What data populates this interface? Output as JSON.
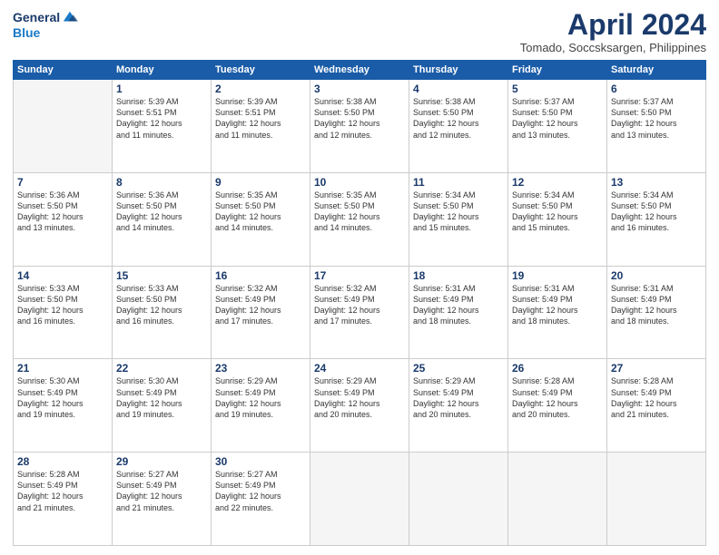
{
  "header": {
    "logo_general": "General",
    "logo_blue": "Blue",
    "month_title": "April 2024",
    "location": "Tomado, Soccsksargen, Philippines"
  },
  "weekdays": [
    "Sunday",
    "Monday",
    "Tuesday",
    "Wednesday",
    "Thursday",
    "Friday",
    "Saturday"
  ],
  "weeks": [
    [
      {
        "day": "",
        "sunrise": "",
        "sunset": "",
        "daylight": ""
      },
      {
        "day": "1",
        "sunrise": "Sunrise: 5:39 AM",
        "sunset": "Sunset: 5:51 PM",
        "daylight": "Daylight: 12 hours and 11 minutes."
      },
      {
        "day": "2",
        "sunrise": "Sunrise: 5:39 AM",
        "sunset": "Sunset: 5:51 PM",
        "daylight": "Daylight: 12 hours and 11 minutes."
      },
      {
        "day": "3",
        "sunrise": "Sunrise: 5:38 AM",
        "sunset": "Sunset: 5:50 PM",
        "daylight": "Daylight: 12 hours and 12 minutes."
      },
      {
        "day": "4",
        "sunrise": "Sunrise: 5:38 AM",
        "sunset": "Sunset: 5:50 PM",
        "daylight": "Daylight: 12 hours and 12 minutes."
      },
      {
        "day": "5",
        "sunrise": "Sunrise: 5:37 AM",
        "sunset": "Sunset: 5:50 PM",
        "daylight": "Daylight: 12 hours and 13 minutes."
      },
      {
        "day": "6",
        "sunrise": "Sunrise: 5:37 AM",
        "sunset": "Sunset: 5:50 PM",
        "daylight": "Daylight: 12 hours and 13 minutes."
      }
    ],
    [
      {
        "day": "7",
        "sunrise": "Sunrise: 5:36 AM",
        "sunset": "Sunset: 5:50 PM",
        "daylight": "Daylight: 12 hours and 13 minutes."
      },
      {
        "day": "8",
        "sunrise": "Sunrise: 5:36 AM",
        "sunset": "Sunset: 5:50 PM",
        "daylight": "Daylight: 12 hours and 14 minutes."
      },
      {
        "day": "9",
        "sunrise": "Sunrise: 5:35 AM",
        "sunset": "Sunset: 5:50 PM",
        "daylight": "Daylight: 12 hours and 14 minutes."
      },
      {
        "day": "10",
        "sunrise": "Sunrise: 5:35 AM",
        "sunset": "Sunset: 5:50 PM",
        "daylight": "Daylight: 12 hours and 14 minutes."
      },
      {
        "day": "11",
        "sunrise": "Sunrise: 5:34 AM",
        "sunset": "Sunset: 5:50 PM",
        "daylight": "Daylight: 12 hours and 15 minutes."
      },
      {
        "day": "12",
        "sunrise": "Sunrise: 5:34 AM",
        "sunset": "Sunset: 5:50 PM",
        "daylight": "Daylight: 12 hours and 15 minutes."
      },
      {
        "day": "13",
        "sunrise": "Sunrise: 5:34 AM",
        "sunset": "Sunset: 5:50 PM",
        "daylight": "Daylight: 12 hours and 16 minutes."
      }
    ],
    [
      {
        "day": "14",
        "sunrise": "Sunrise: 5:33 AM",
        "sunset": "Sunset: 5:50 PM",
        "daylight": "Daylight: 12 hours and 16 minutes."
      },
      {
        "day": "15",
        "sunrise": "Sunrise: 5:33 AM",
        "sunset": "Sunset: 5:50 PM",
        "daylight": "Daylight: 12 hours and 16 minutes."
      },
      {
        "day": "16",
        "sunrise": "Sunrise: 5:32 AM",
        "sunset": "Sunset: 5:49 PM",
        "daylight": "Daylight: 12 hours and 17 minutes."
      },
      {
        "day": "17",
        "sunrise": "Sunrise: 5:32 AM",
        "sunset": "Sunset: 5:49 PM",
        "daylight": "Daylight: 12 hours and 17 minutes."
      },
      {
        "day": "18",
        "sunrise": "Sunrise: 5:31 AM",
        "sunset": "Sunset: 5:49 PM",
        "daylight": "Daylight: 12 hours and 18 minutes."
      },
      {
        "day": "19",
        "sunrise": "Sunrise: 5:31 AM",
        "sunset": "Sunset: 5:49 PM",
        "daylight": "Daylight: 12 hours and 18 minutes."
      },
      {
        "day": "20",
        "sunrise": "Sunrise: 5:31 AM",
        "sunset": "Sunset: 5:49 PM",
        "daylight": "Daylight: 12 hours and 18 minutes."
      }
    ],
    [
      {
        "day": "21",
        "sunrise": "Sunrise: 5:30 AM",
        "sunset": "Sunset: 5:49 PM",
        "daylight": "Daylight: 12 hours and 19 minutes."
      },
      {
        "day": "22",
        "sunrise": "Sunrise: 5:30 AM",
        "sunset": "Sunset: 5:49 PM",
        "daylight": "Daylight: 12 hours and 19 minutes."
      },
      {
        "day": "23",
        "sunrise": "Sunrise: 5:29 AM",
        "sunset": "Sunset: 5:49 PM",
        "daylight": "Daylight: 12 hours and 19 minutes."
      },
      {
        "day": "24",
        "sunrise": "Sunrise: 5:29 AM",
        "sunset": "Sunset: 5:49 PM",
        "daylight": "Daylight: 12 hours and 20 minutes."
      },
      {
        "day": "25",
        "sunrise": "Sunrise: 5:29 AM",
        "sunset": "Sunset: 5:49 PM",
        "daylight": "Daylight: 12 hours and 20 minutes."
      },
      {
        "day": "26",
        "sunrise": "Sunrise: 5:28 AM",
        "sunset": "Sunset: 5:49 PM",
        "daylight": "Daylight: 12 hours and 20 minutes."
      },
      {
        "day": "27",
        "sunrise": "Sunrise: 5:28 AM",
        "sunset": "Sunset: 5:49 PM",
        "daylight": "Daylight: 12 hours and 21 minutes."
      }
    ],
    [
      {
        "day": "28",
        "sunrise": "Sunrise: 5:28 AM",
        "sunset": "Sunset: 5:49 PM",
        "daylight": "Daylight: 12 hours and 21 minutes."
      },
      {
        "day": "29",
        "sunrise": "Sunrise: 5:27 AM",
        "sunset": "Sunset: 5:49 PM",
        "daylight": "Daylight: 12 hours and 21 minutes."
      },
      {
        "day": "30",
        "sunrise": "Sunrise: 5:27 AM",
        "sunset": "Sunset: 5:49 PM",
        "daylight": "Daylight: 12 hours and 22 minutes."
      },
      {
        "day": "",
        "sunrise": "",
        "sunset": "",
        "daylight": ""
      },
      {
        "day": "",
        "sunrise": "",
        "sunset": "",
        "daylight": ""
      },
      {
        "day": "",
        "sunrise": "",
        "sunset": "",
        "daylight": ""
      },
      {
        "day": "",
        "sunrise": "",
        "sunset": "",
        "daylight": ""
      }
    ]
  ]
}
